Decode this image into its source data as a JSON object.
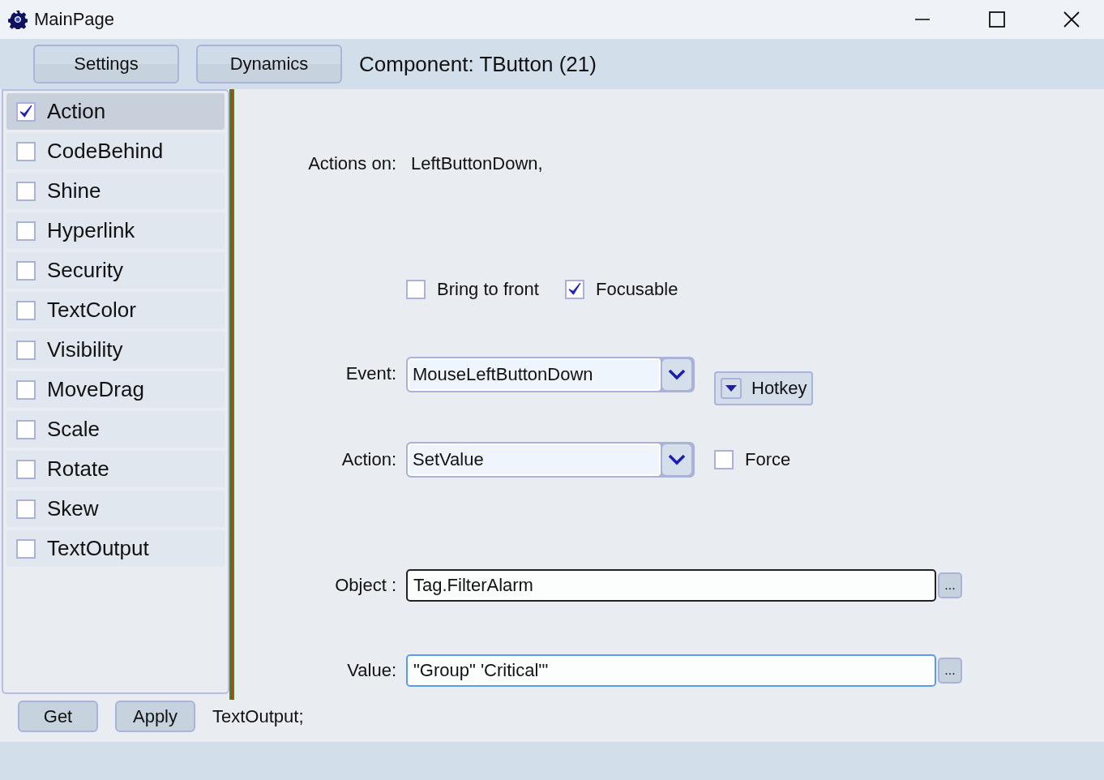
{
  "window": {
    "title": "MainPage"
  },
  "toolbar": {
    "buttons": [
      "Settings",
      "Dynamics"
    ],
    "component_label": "Component: TButton (21)"
  },
  "dynamics": [
    {
      "label": "Action",
      "checked": true,
      "selected": true
    },
    {
      "label": "CodeBehind",
      "checked": false,
      "selected": false
    },
    {
      "label": "Shine",
      "checked": false,
      "selected": false
    },
    {
      "label": "Hyperlink",
      "checked": false,
      "selected": false
    },
    {
      "label": "Security",
      "checked": false,
      "selected": false
    },
    {
      "label": "TextColor",
      "checked": false,
      "selected": false
    },
    {
      "label": "Visibility",
      "checked": false,
      "selected": false
    },
    {
      "label": "MoveDrag",
      "checked": false,
      "selected": false
    },
    {
      "label": "Scale",
      "checked": false,
      "selected": false
    },
    {
      "label": "Rotate",
      "checked": false,
      "selected": false
    },
    {
      "label": "Skew",
      "checked": false,
      "selected": false
    },
    {
      "label": "TextOutput",
      "checked": false,
      "selected": false
    }
  ],
  "action_panel": {
    "actions_on_label": "Actions on:",
    "actions_on_value": "LeftButtonDown,",
    "options": [
      {
        "label": "Bring to front",
        "checked": false
      },
      {
        "label": "Focusable",
        "checked": true
      }
    ],
    "event": {
      "label": "Event:",
      "value": "MouseLeftButtonDown"
    },
    "hotkey_button": "Hotkey",
    "action": {
      "label": "Action:",
      "value": "SetValue"
    },
    "force": {
      "label": "Force",
      "checked": false
    },
    "object": {
      "label": "Object :",
      "value": "Tag.FilterAlarm",
      "browse": "...",
      "focused": false
    },
    "value": {
      "label": "Value:",
      "value": "\"Group\" 'Critical'\"",
      "browse": "...",
      "focused": true
    }
  },
  "footer": {
    "buttons": [
      "Get",
      "Apply"
    ],
    "status": "TextOutput;"
  }
}
